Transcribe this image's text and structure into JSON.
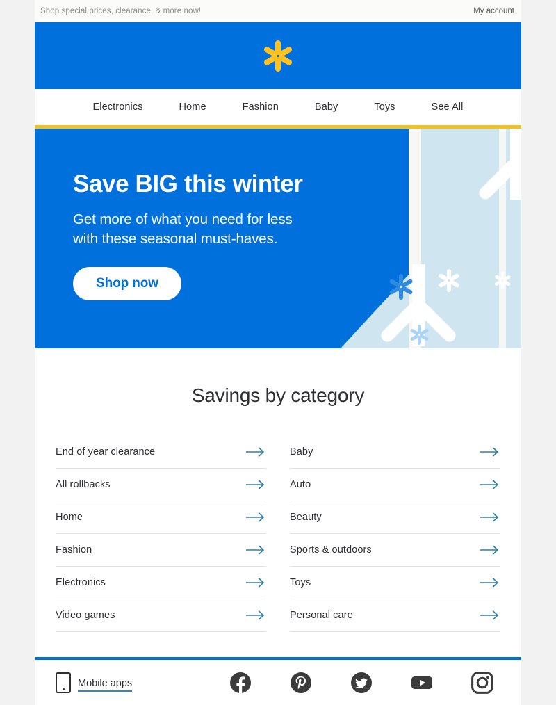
{
  "preheader": {
    "promo_text": "Shop special prices, clearance, & more now!",
    "account_label": "My account"
  },
  "brand": {
    "logo_name": "walmart-spark-logo",
    "blue": "#0071dc",
    "yellow": "#ffc220",
    "rule_yellow": "#f2c31c"
  },
  "nav": {
    "items": [
      {
        "label": "Electronics"
      },
      {
        "label": "Home"
      },
      {
        "label": "Fashion"
      },
      {
        "label": "Baby"
      },
      {
        "label": "Toys"
      },
      {
        "label": "See All"
      }
    ]
  },
  "hero": {
    "title": "Save BIG this winter",
    "subtitle_line1": "Get more of what you need for less",
    "subtitle_line2": "with these seasonal must-haves.",
    "cta_label": "Shop now",
    "background_color": "#0071dc",
    "panel_color": "#cfe5ef"
  },
  "categories": {
    "title": "Savings by category",
    "left_column": [
      {
        "label": "End of year clearance"
      },
      {
        "label": "All rollbacks"
      },
      {
        "label": "Home"
      },
      {
        "label": "Fashion"
      },
      {
        "label": "Electronics"
      },
      {
        "label": "Video games"
      }
    ],
    "right_column": [
      {
        "label": "Baby"
      },
      {
        "label": "Auto"
      },
      {
        "label": "Beauty"
      },
      {
        "label": "Sports & outdoors"
      },
      {
        "label": "Toys"
      },
      {
        "label": "Personal care"
      }
    ],
    "arrow_color": "#2f7fa8"
  },
  "footer": {
    "mobile_apps_label": "Mobile apps",
    "phone_icon": "mobile-phone-icon",
    "divider_color": "#0071dc",
    "socials": [
      {
        "name": "facebook-icon"
      },
      {
        "name": "pinterest-icon"
      },
      {
        "name": "twitter-icon"
      },
      {
        "name": "youtube-icon"
      },
      {
        "name": "instagram-icon"
      }
    ]
  }
}
